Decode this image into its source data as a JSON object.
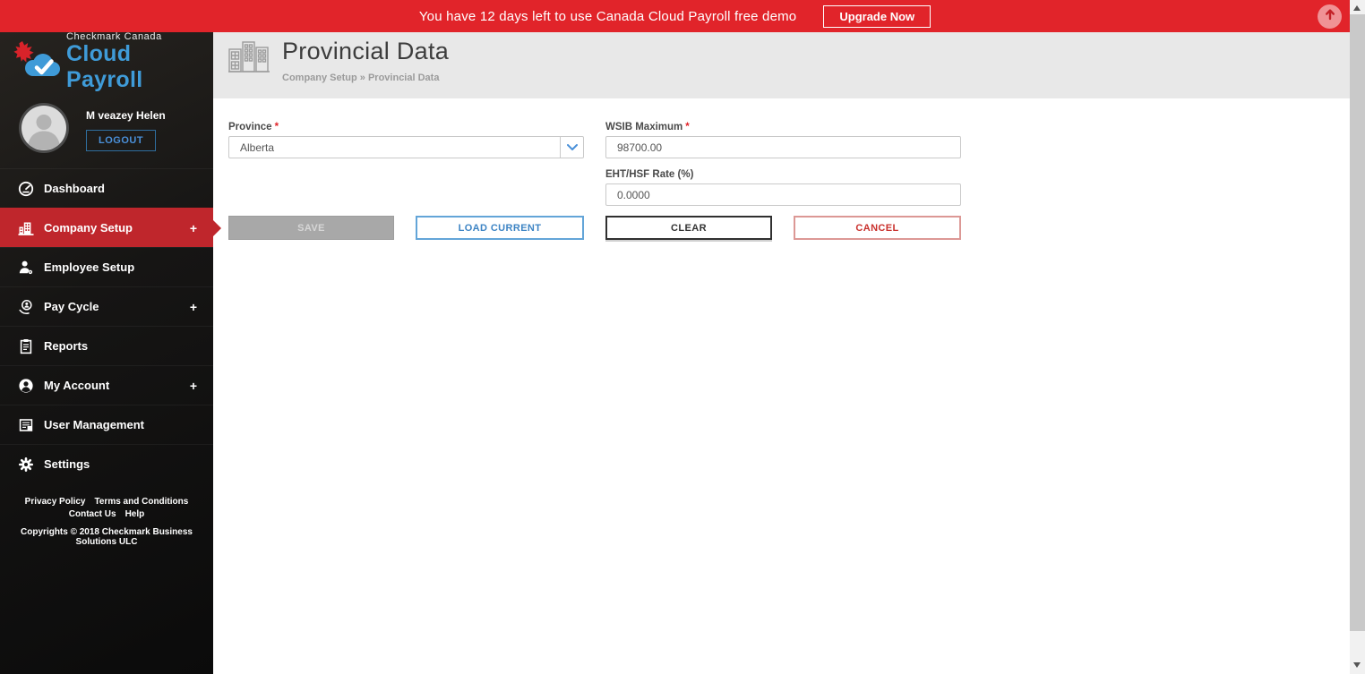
{
  "banner": {
    "message": "You have 12 days left to use Canada Cloud Payroll free demo",
    "upgrade_button": "Upgrade Now"
  },
  "logo": {
    "line1": "Checkmark Canada",
    "line2": "Cloud Payroll"
  },
  "user": {
    "name": "M veazey Helen",
    "logout_button": "LOGOUT"
  },
  "sidebar": {
    "plus_glyph": "+",
    "items": [
      {
        "label": "Dashboard",
        "icon": "dashboard-icon",
        "expandable": false,
        "active": false
      },
      {
        "label": "Company Setup",
        "icon": "company-setup-icon",
        "expandable": true,
        "active": true
      },
      {
        "label": "Employee Setup",
        "icon": "employee-setup-icon",
        "expandable": false,
        "active": false
      },
      {
        "label": "Pay Cycle",
        "icon": "pay-cycle-icon",
        "expandable": true,
        "active": false
      },
      {
        "label": "Reports",
        "icon": "reports-icon",
        "expandable": false,
        "active": false
      },
      {
        "label": "My Account",
        "icon": "my-account-icon",
        "expandable": true,
        "active": false
      },
      {
        "label": "User Management",
        "icon": "user-management-icon",
        "expandable": false,
        "active": false
      },
      {
        "label": "Settings",
        "icon": "settings-icon",
        "expandable": false,
        "active": false
      }
    ],
    "footer_links": [
      "Privacy Policy",
      "Terms and Conditions",
      "Contact Us",
      "Help"
    ],
    "copyright": "Copyrights © 2018 Checkmark Business Solutions ULC"
  },
  "page": {
    "title": "Provincial Data",
    "breadcrumb": "Company Setup » Provincial Data"
  },
  "form": {
    "required_mark": "*",
    "province": {
      "label": "Province",
      "value": "Alberta"
    },
    "wsib_maximum": {
      "label": "WSIB Maximum",
      "value": "98700.00"
    },
    "eht_rate": {
      "label": "EHT/HSF Rate (%)",
      "value": "0.0000"
    },
    "buttons": {
      "save": "SAVE",
      "load_current": "LOAD CURRENT",
      "clear": "CLEAR",
      "cancel": "CANCEL"
    }
  },
  "colors": {
    "banner_red": "#e1242a",
    "active_nav_red": "#bf262c",
    "brand_blue": "#3f9bd8",
    "link_blue": "#4a90d9",
    "cancel_red": "#c9302c"
  }
}
